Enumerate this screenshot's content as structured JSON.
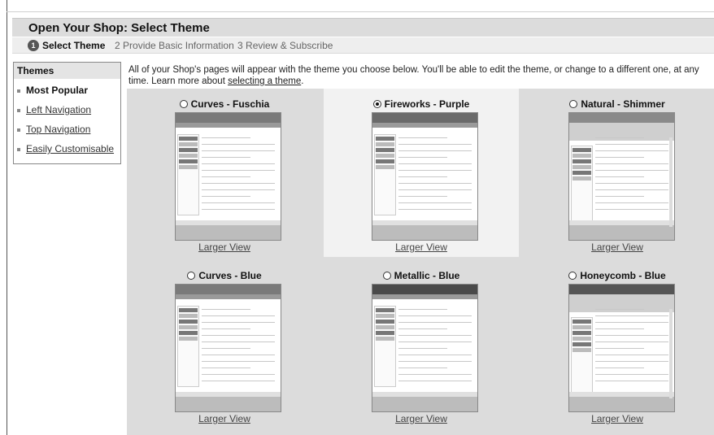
{
  "header": {
    "title": "Open Your Shop: Select Theme"
  },
  "steps": [
    {
      "number": "1",
      "label": "Select Theme",
      "active": true
    },
    {
      "number": "2",
      "label": "Provide Basic Information",
      "active": false
    },
    {
      "number": "3",
      "label": "Review & Subscribe",
      "active": false
    }
  ],
  "sidebar": {
    "heading": "Themes",
    "items": [
      {
        "label": "Most Popular",
        "active": true
      },
      {
        "label": "Left Navigation",
        "active": false
      },
      {
        "label": "Top Navigation",
        "active": false
      },
      {
        "label": "Easily Customisable",
        "active": false
      }
    ]
  },
  "intro": {
    "text": "All of your Shop's pages will appear with the theme you choose below. You'll be able to edit the theme, or change to a different one, at any time. Learn more about ",
    "link": "selecting a theme",
    "suffix": "."
  },
  "themes": [
    {
      "name": "Curves - Fuschia",
      "selected": false,
      "larger_view": "Larger View",
      "style": "curves"
    },
    {
      "name": "Fireworks - Purple",
      "selected": true,
      "larger_view": "Larger View",
      "style": "fireworks"
    },
    {
      "name": "Natural - Shimmer",
      "selected": false,
      "larger_view": "Larger View",
      "style": "natural"
    },
    {
      "name": "Curves - Blue",
      "selected": false,
      "larger_view": "Larger View",
      "style": "curves"
    },
    {
      "name": "Metallic - Blue",
      "selected": false,
      "larger_view": "Larger View",
      "style": "metallic"
    },
    {
      "name": "Honeycomb - Blue",
      "selected": false,
      "larger_view": "Larger View",
      "style": "honeycomb"
    }
  ],
  "colors": {
    "grid_background": "#dcdcdc",
    "selected_cell": "#f2f2f2",
    "title_bar": "#dcdcdc"
  }
}
